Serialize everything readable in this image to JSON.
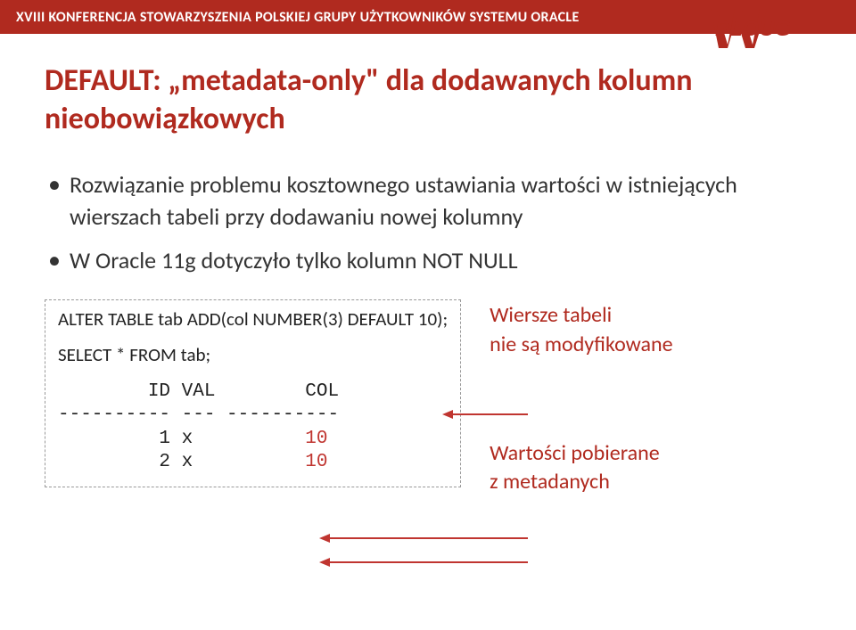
{
  "header": {
    "conference_title": "XVIII KONFERENCJA STOWARZYSZENIA POLSKIEJ GRUPY UŻYTKOWNIKÓW SYSTEMU ORACLE",
    "logo_text": "PLOUG"
  },
  "slide": {
    "title": "DEFAULT: „metadata-only\" dla dodawanych kolumn nieobowiązkowych",
    "bullets": [
      "Rozwiązanie problemu kosztownego ustawiania wartości w istniejących wierszach tabeli przy dodawaniu nowej kolumny",
      "W Oracle 11g dotyczyło tylko kolumn NOT NULL"
    ]
  },
  "code": {
    "line1": "ALTER TABLE tab ADD(col NUMBER(3) DEFAULT 10);",
    "line2": "SELECT * FROM tab;",
    "output_header": "        ID VAL        COL",
    "output_divider": "---------- --- ----------",
    "output_row1_left": "         1 x          ",
    "output_row1_col": "10",
    "output_row2_left": "         2 x          ",
    "output_row2_col": "10"
  },
  "annotations": {
    "top": "Wiersze tabeli\nnie są modyfikowane",
    "bottom": "Wartości pobierane\nz metadanych"
  }
}
